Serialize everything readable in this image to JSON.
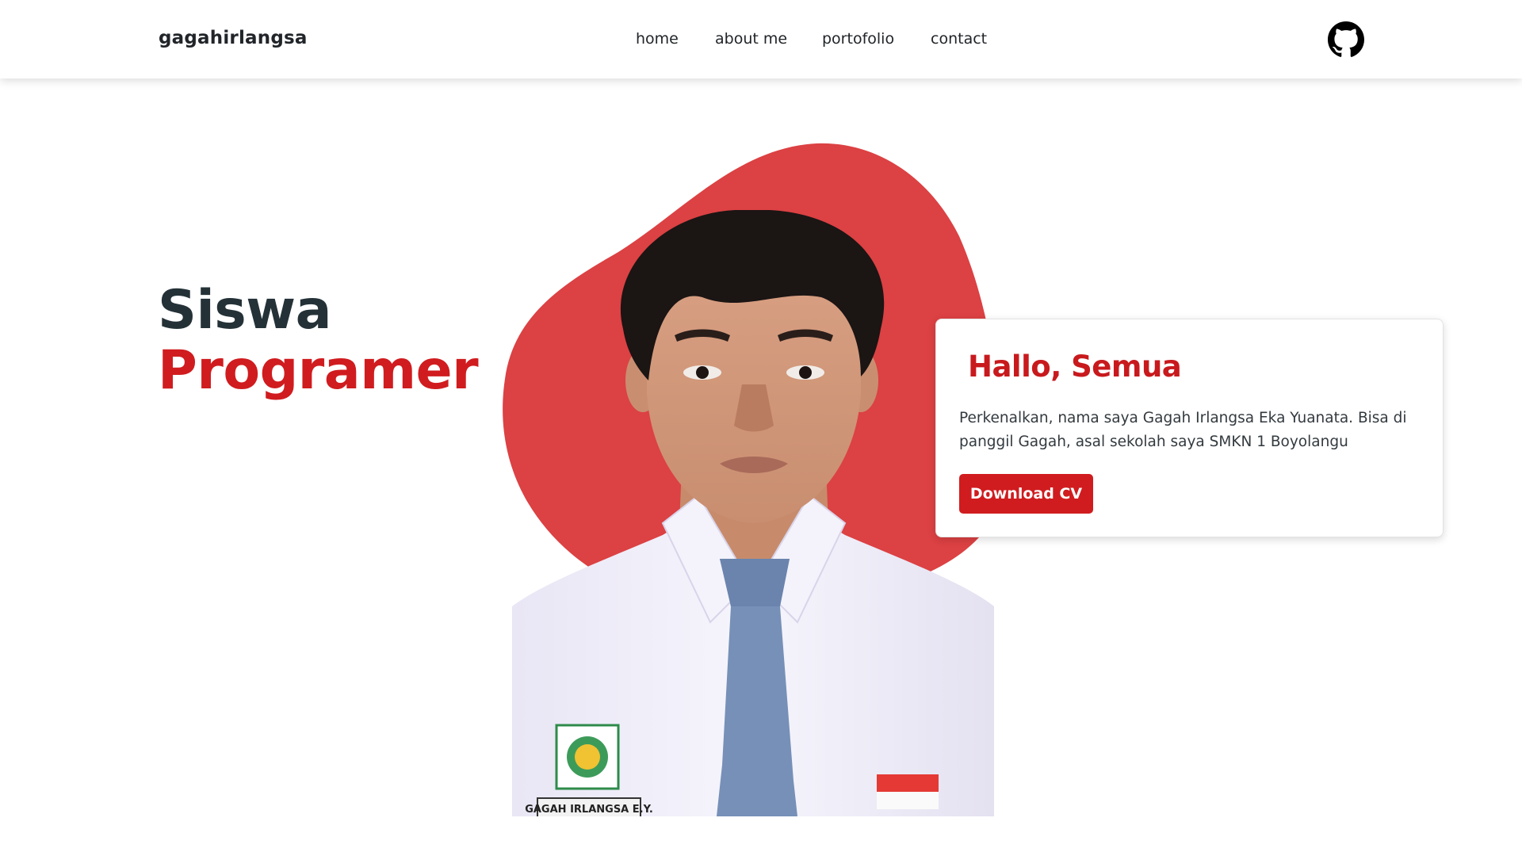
{
  "colors": {
    "accent": "#d01c1f",
    "blob": "#dc4143",
    "heading_dark": "#243238",
    "text": "#212529"
  },
  "navbar": {
    "brand": "gagahirlangsa",
    "links": [
      {
        "label": "home"
      },
      {
        "label": "about me"
      },
      {
        "label": "portofolio"
      },
      {
        "label": "contact"
      }
    ],
    "github_icon": "github-icon"
  },
  "hero": {
    "title_line1": "Siswa",
    "title_line2": "Programer",
    "photo_icon": "student-portrait-photo"
  },
  "intro_card": {
    "greeting": "Hallo, Semua",
    "description": "Perkenalkan, nama saya Gagah Irlangsa Eka Yuanata. Bisa di panggil Gagah, asal sekolah saya SMKN 1 Boyolangu",
    "button_label": "Download CV"
  },
  "photo_details": {
    "name_tag": "GAGAH IRLANGSA E.Y."
  }
}
